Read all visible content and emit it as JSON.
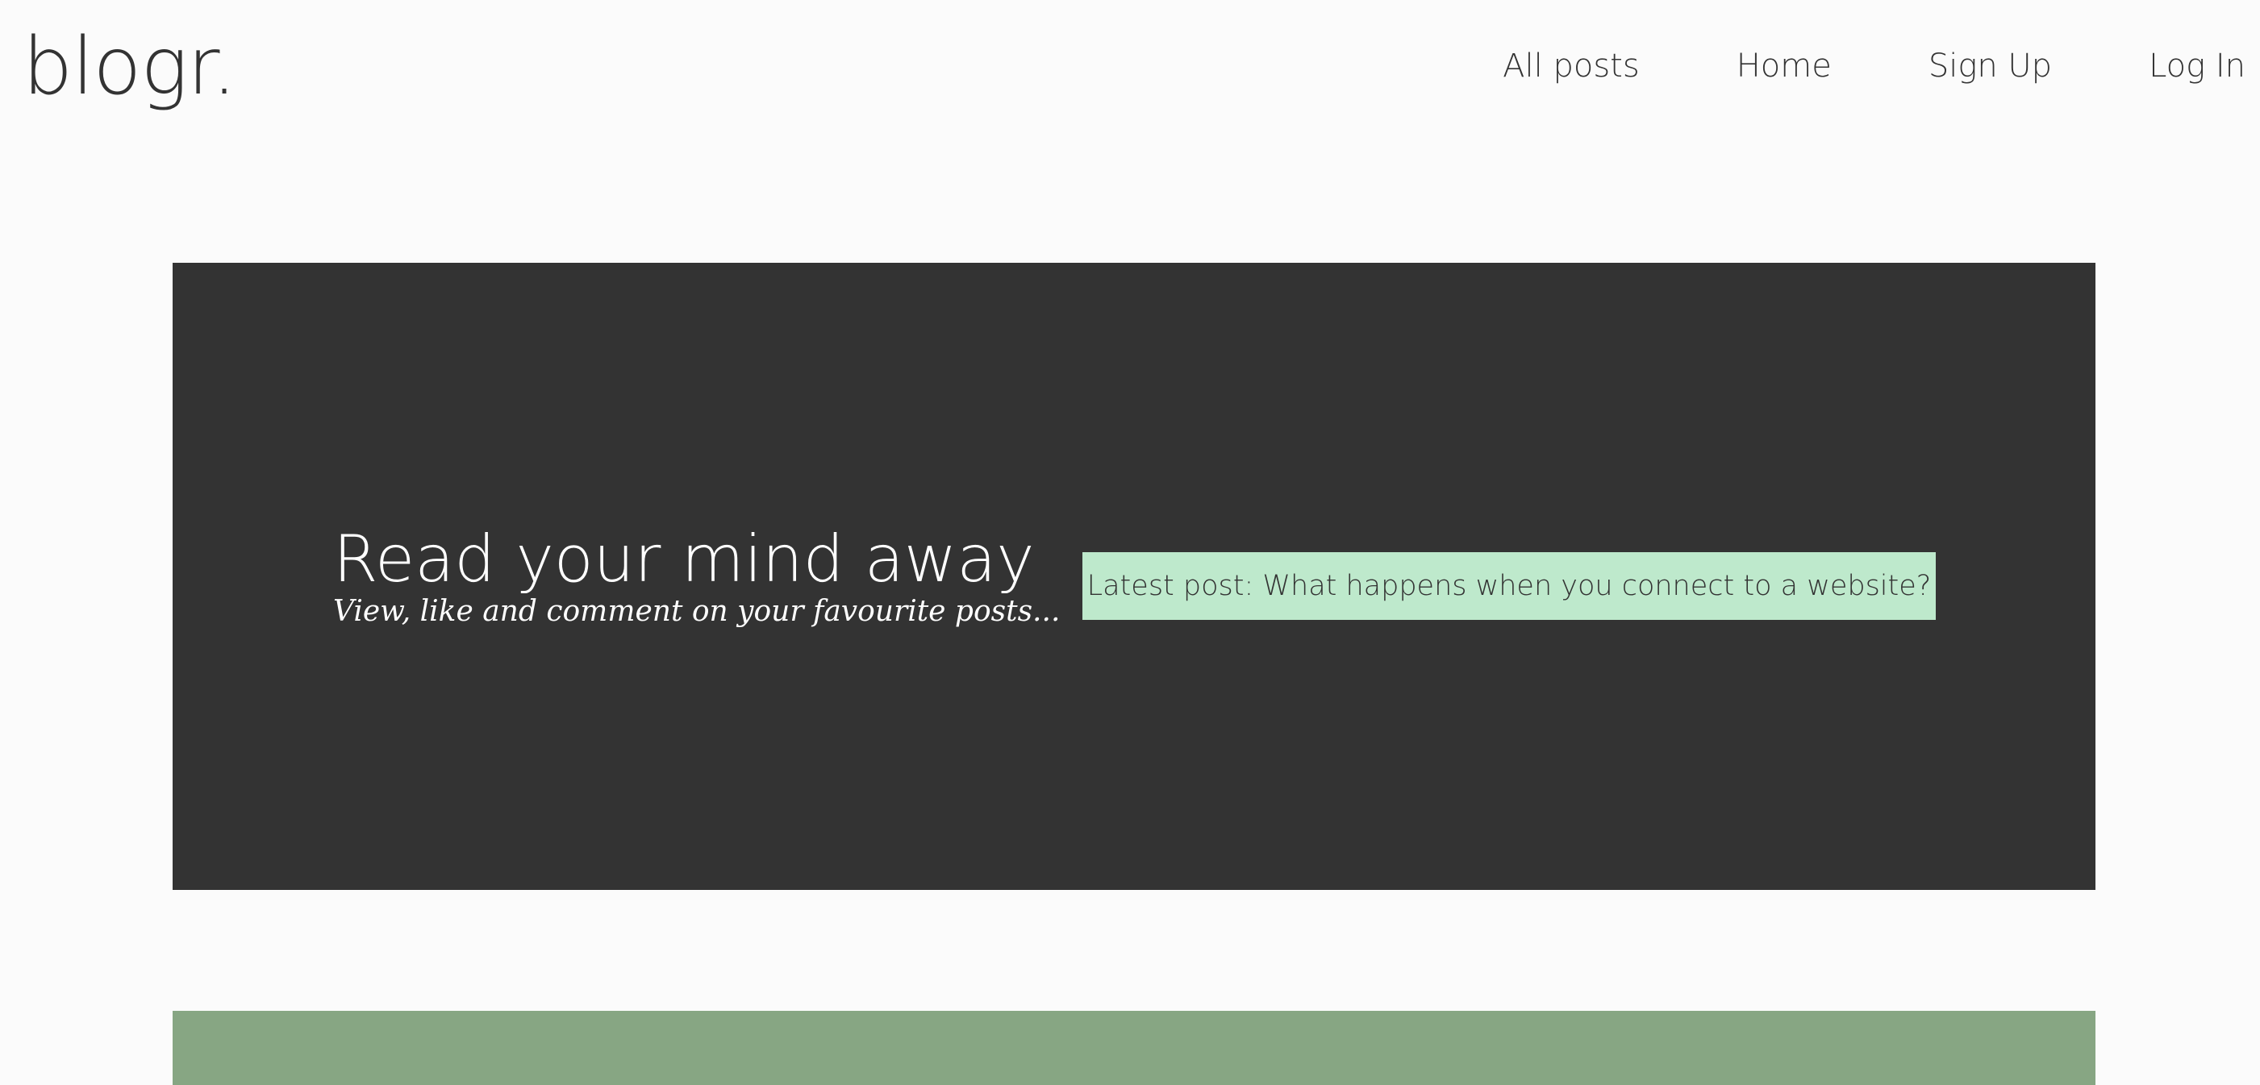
{
  "header": {
    "logo": "blogr.",
    "nav": [
      {
        "label": "All posts"
      },
      {
        "label": "Home"
      },
      {
        "label": "Sign Up"
      },
      {
        "label": "Log In"
      }
    ]
  },
  "hero": {
    "title": "Read your mind away",
    "subtitle": "View, like and comment on your favourite posts...",
    "latest_post": "Latest post: What happens when you connect to a website?"
  },
  "colors": {
    "background": "#fbfbfb",
    "text": "#333333",
    "hero_background": "#333333",
    "latest_post_background": "#bee9cc",
    "section_strip": "#87a683"
  }
}
